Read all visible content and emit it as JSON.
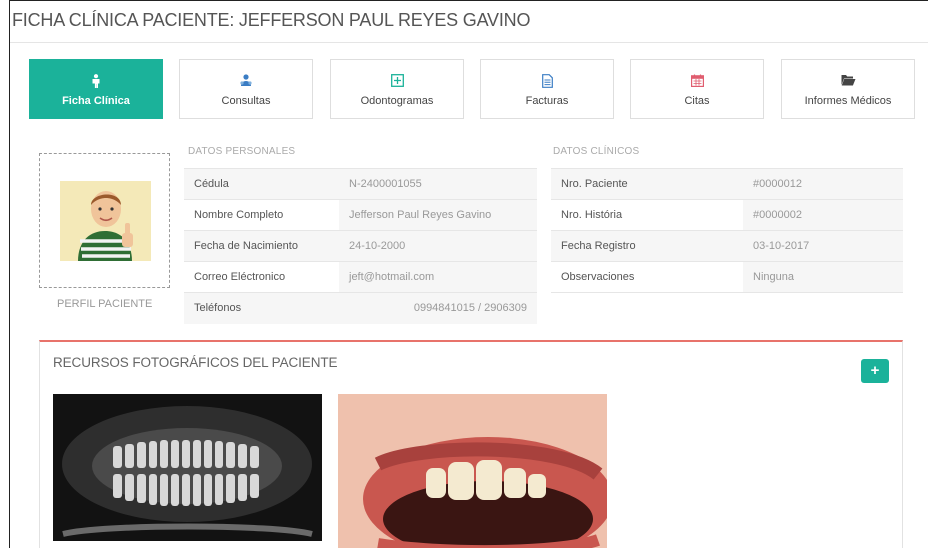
{
  "page": {
    "title": "FICHA CLÍNICA PACIENTE: JEFFERSON PAUL REYES GAVINO"
  },
  "tabs": [
    {
      "label": "Ficha Clínica",
      "icon": "person-icon",
      "active": true
    },
    {
      "label": "Consultas",
      "icon": "users-icon"
    },
    {
      "label": "Odontogramas",
      "icon": "grid-plus-icon"
    },
    {
      "label": "Facturas",
      "icon": "document-icon"
    },
    {
      "label": "Citas",
      "icon": "calendar-icon"
    },
    {
      "label": "Informes Médicos",
      "icon": "folder-open-icon"
    }
  ],
  "profile": {
    "label": "PERFIL PACIENTE"
  },
  "personal": {
    "heading": "DATOS PERSONALES",
    "rows": [
      {
        "label": "Cédula",
        "value": "N-2400001055"
      },
      {
        "label": "Nombre Completo",
        "value": "Jefferson Paul Reyes Gavino"
      },
      {
        "label": "Fecha de Nacimiento",
        "value": "24-10-2000"
      },
      {
        "label": "Correo Eléctronico",
        "value": "jeft@hotmail.com"
      },
      {
        "label": "Teléfonos",
        "value": "0994841015 / 2906309"
      }
    ]
  },
  "clinical": {
    "heading": "DATOS CLÍNICOS",
    "rows": [
      {
        "label": "Nro. Paciente",
        "value": "#0000012"
      },
      {
        "label": "Nro. História",
        "value": "#0000002"
      },
      {
        "label": "Fecha Registro",
        "value": "03-10-2017"
      },
      {
        "label": "Observaciones",
        "value": "Ninguna"
      }
    ]
  },
  "photos": {
    "title": "RECURSOS FOTOGRÁFICOS DEL PACIENTE",
    "add_label": "+"
  },
  "colors": {
    "accent": "#1bb29a",
    "panel_border": "#e8736b",
    "calendar": "#e05d6f",
    "icon_blue": "#3b7dc4"
  }
}
